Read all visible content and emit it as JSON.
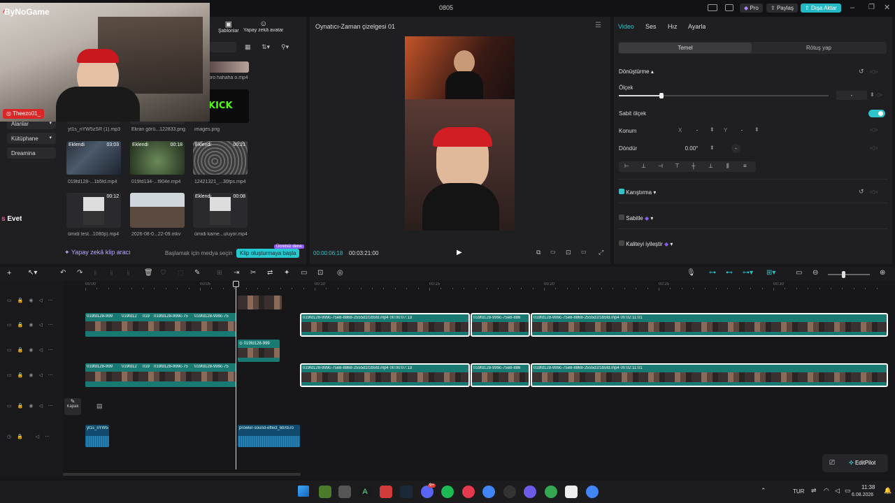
{
  "app": {
    "title": "0805"
  },
  "topbar": {
    "pro_label": "Pro",
    "share_label": "Paylaş",
    "export_label": "Dışa Aktar"
  },
  "webcam": {
    "brand": "ByNoGame",
    "instagram": "Theezo01_"
  },
  "left_panel": {
    "top_tabs": [
      {
        "label": "Şablonlar"
      },
      {
        "label": "Yapay zekâ avatar"
      }
    ],
    "nav_items": [
      {
        "label": "Alanlar"
      },
      {
        "label": "Kütüphane"
      },
      {
        "label": "Dreamina"
      }
    ],
    "overlay_text": "Evet",
    "media": [
      {
        "name": "bro hahaha o.mp4",
        "badge": "",
        "duration": ""
      },
      {
        "name": "yt1s_nYW5zSR (1).mp3",
        "badge": "",
        "duration": ""
      },
      {
        "name": "Ekran görü...122833.png",
        "badge": "",
        "duration": ""
      },
      {
        "name": "images.png",
        "badge": "",
        "duration": ""
      },
      {
        "name": "019fd128-...1b5fd.mp4",
        "badge": "Eklendi",
        "duration": "03:03"
      },
      {
        "name": "019fd134-...f904e.mp4",
        "badge": "Eklendi",
        "duration": "00:18"
      },
      {
        "name": "12421321_...30fps.mp4",
        "badge": "Eklendi",
        "duration": "00:21"
      },
      {
        "name": "ümidi test...1080p).mp4",
        "badge": "",
        "duration": "00:12"
      },
      {
        "name": "2026-08-0...22-09.mkv",
        "badge": "",
        "duration": ""
      },
      {
        "name": "ümidi kame...uluyor.mp4",
        "badge": "Eklendi",
        "duration": "00:08"
      }
    ],
    "kick_text": "KICK",
    "ai_clip_label": "Yapay zekâ klip aracı",
    "select_media_hint": "Başlamak için medya seçin",
    "start_clip_button": "Klip oluşturmaya başla",
    "free_trial_badge": "Ücretsiz dene"
  },
  "player": {
    "title": "Oynatıcı-Zaman çizelgesi 01",
    "current_time": "00:00:06:18",
    "total_time": "00:03:21:00"
  },
  "inspector": {
    "tabs": [
      {
        "label": "Video"
      },
      {
        "label": "Ses"
      },
      {
        "label": "Hız"
      },
      {
        "label": "Ayarla"
      }
    ],
    "subtabs": [
      {
        "label": "Temel"
      },
      {
        "label": "Rötuş yap"
      }
    ],
    "transform_label": "Dönüştürme",
    "scale_label": "Ölçek",
    "scale_value": "-",
    "uniform_scale_label": "Sabit ölçek",
    "position_label": "Konum",
    "x_label": "X",
    "x_value": "-",
    "y_label": "Y",
    "y_value": "-",
    "rotate_label": "Döndür",
    "rotate_value": "0.00°",
    "rotate_dash": "-",
    "blend_label": "Karıştırma",
    "stabilize_label": "Sabitle",
    "quality_label": "Kaliteyi iyileştir"
  },
  "timeline": {
    "ruler": [
      {
        "label": "00:00"
      },
      {
        "label": "00:05"
      },
      {
        "label": "00:10"
      },
      {
        "label": "00:15"
      },
      {
        "label": "00:20"
      },
      {
        "label": "00:25"
      },
      {
        "label": "00:30"
      }
    ],
    "clip_prefix": "019fd128-999",
    "clip_a": "019fd128-999c-75e8-8868-2555d1f1b5fd.mp4",
    "clip_a_time": "00:00:07:13",
    "clip_b": "019fd128-999c-75e8-886",
    "clip_c": "019fd128-999c-75e8-8868-2555d1f1b5fd.mp4",
    "clip_c_time": "00:02:11:01",
    "clip_short": "019fd12",
    "clip_019": "019",
    "clip_mid": "019fd128-999c-75",
    "clip_mid2": "019fd128-999c-75",
    "audio_1": "yt1s_nYW5",
    "audio_2": "prowler-sound-effect_6bXEro",
    "cover_label": "Kapak",
    "editpilot_label": "EditPilot"
  },
  "taskbar": {
    "language": "TUR",
    "time": "11:38",
    "date": "6.08.2026",
    "badge": "9+"
  },
  "colors": {
    "accent": "#2ec4c9",
    "clip": "#187a72",
    "background": "#161618"
  }
}
